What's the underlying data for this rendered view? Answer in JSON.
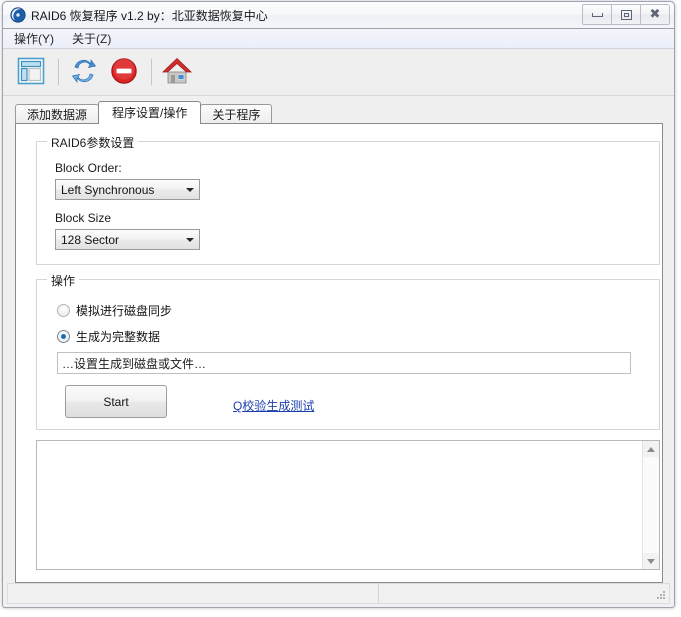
{
  "window": {
    "title": "RAID6 恢复程序 v1.2 by：北亚数据恢复中心",
    "app_icon": "disc-icon",
    "minimize_label": "最小化",
    "maximize_label": "最大化",
    "close_label": "关闭",
    "accent_color": "#1a6fb5",
    "link_color": "#1b3fae"
  },
  "menu": {
    "items": [
      {
        "label": "操作(Y)",
        "name": "menu-operations"
      },
      {
        "label": "关于(Z)",
        "name": "menu-about"
      }
    ]
  },
  "toolbar": {
    "buttons": [
      {
        "icon": "layout-panel-icon",
        "name": "toolbar-layout-button"
      },
      {
        "icon": "refresh-icon",
        "name": "toolbar-refresh-button"
      },
      {
        "icon": "stop-icon",
        "name": "toolbar-stop-button"
      },
      {
        "icon": "home-icon",
        "name": "toolbar-home-button"
      }
    ]
  },
  "tabs": [
    {
      "label": "添加数据源",
      "active": false
    },
    {
      "label": "程序设置/操作",
      "active": true
    },
    {
      "label": "关于程序",
      "active": false
    }
  ],
  "params_group": {
    "title": "RAID6参数设置",
    "block_order_label": "Block Order:",
    "block_order_value": "Left Synchronous",
    "block_size_label": "Block Size",
    "block_size_value": "128 Sector"
  },
  "ops_group": {
    "title": "操作",
    "radio_sync": {
      "label": "模拟进行磁盘同步",
      "checked": false
    },
    "radio_generate": {
      "label": "生成为完整数据",
      "checked": true
    },
    "target_input": {
      "value": "…设置生成到磁盘或文件…",
      "placeholder": "…设置生成到磁盘或文件…"
    },
    "start_button": "Start",
    "test_link": "Q校验生成测试"
  },
  "log": {
    "text": ""
  },
  "statusbar": {
    "left_text": "",
    "right_text": "",
    "grip": "resize-grip-icon"
  }
}
